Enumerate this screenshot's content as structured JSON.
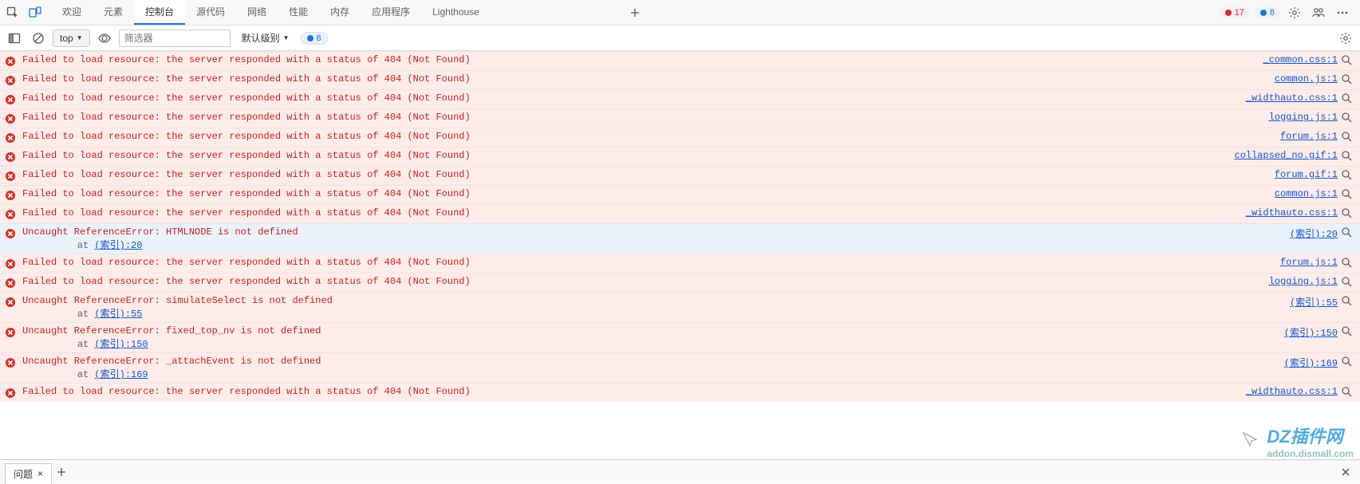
{
  "tabbar": {
    "tabs": [
      "欢迎",
      "元素",
      "控制台",
      "源代码",
      "网络",
      "性能",
      "内存",
      "应用程序",
      "Lighthouse"
    ],
    "active_index": 2,
    "error_count": "17",
    "info_count": "8"
  },
  "toolbar": {
    "context": "top",
    "filter_placeholder": "筛选器",
    "level_label": "默认级别",
    "hidden_count": "8",
    "settings_title": "控制台设置"
  },
  "messages": [
    {
      "type": "error",
      "text": "Failed to load resource: the server responded with a status of 404 (Not Found)",
      "source": "_common.css:1"
    },
    {
      "type": "error",
      "text": "Failed to load resource: the server responded with a status of 404 (Not Found)",
      "source": "common.js:1"
    },
    {
      "type": "error",
      "text": "Failed to load resource: the server responded with a status of 404 (Not Found)",
      "source": "_widthauto.css:1"
    },
    {
      "type": "error",
      "text": "Failed to load resource: the server responded with a status of 404 (Not Found)",
      "source": "logging.js:1"
    },
    {
      "type": "error",
      "text": "Failed to load resource: the server responded with a status of 404 (Not Found)",
      "source": "forum.js:1"
    },
    {
      "type": "error",
      "text": "Failed to load resource: the server responded with a status of 404 (Not Found)",
      "source": "collapsed_no.gif:1"
    },
    {
      "type": "error",
      "text": "Failed to load resource: the server responded with a status of 404 (Not Found)",
      "source": "forum.gif:1"
    },
    {
      "type": "error",
      "text": "Failed to load resource: the server responded with a status of 404 (Not Found)",
      "source": "common.js:1"
    },
    {
      "type": "error",
      "text": "Failed to load resource: the server responded with a status of 404 (Not Found)",
      "source": "_widthauto.css:1"
    },
    {
      "type": "error-stack",
      "variant": "hl",
      "text": "Uncaught ReferenceError: HTMLNODE is not defined",
      "at": "at ",
      "stack_link": "(索引):20",
      "source": "(索引):20"
    },
    {
      "type": "error",
      "text": "Failed to load resource: the server responded with a status of 404 (Not Found)",
      "source": "forum.js:1"
    },
    {
      "type": "error",
      "text": "Failed to load resource: the server responded with a status of 404 (Not Found)",
      "source": "logging.js:1"
    },
    {
      "type": "error-stack",
      "text": "Uncaught ReferenceError: simulateSelect is not defined",
      "at": "at ",
      "stack_link": "(索引):55",
      "source": "(索引):55"
    },
    {
      "type": "error-stack",
      "text": "Uncaught ReferenceError: fixed_top_nv is not defined",
      "at": "at ",
      "stack_link": "(索引):150",
      "source": "(索引):150"
    },
    {
      "type": "error-stack",
      "text": "Uncaught ReferenceError: _attachEvent is not defined",
      "at": "at ",
      "stack_link": "(索引):169",
      "source": "(索引):169"
    },
    {
      "type": "error",
      "text": "Failed to load resource: the server responded with a status of 404 (Not Found)",
      "source": "_widthauto.css:1"
    }
  ],
  "drawer": {
    "tab_label": "问题"
  },
  "watermark": {
    "brand": "DZ插件网",
    "sub": "addon.dismall.com"
  }
}
